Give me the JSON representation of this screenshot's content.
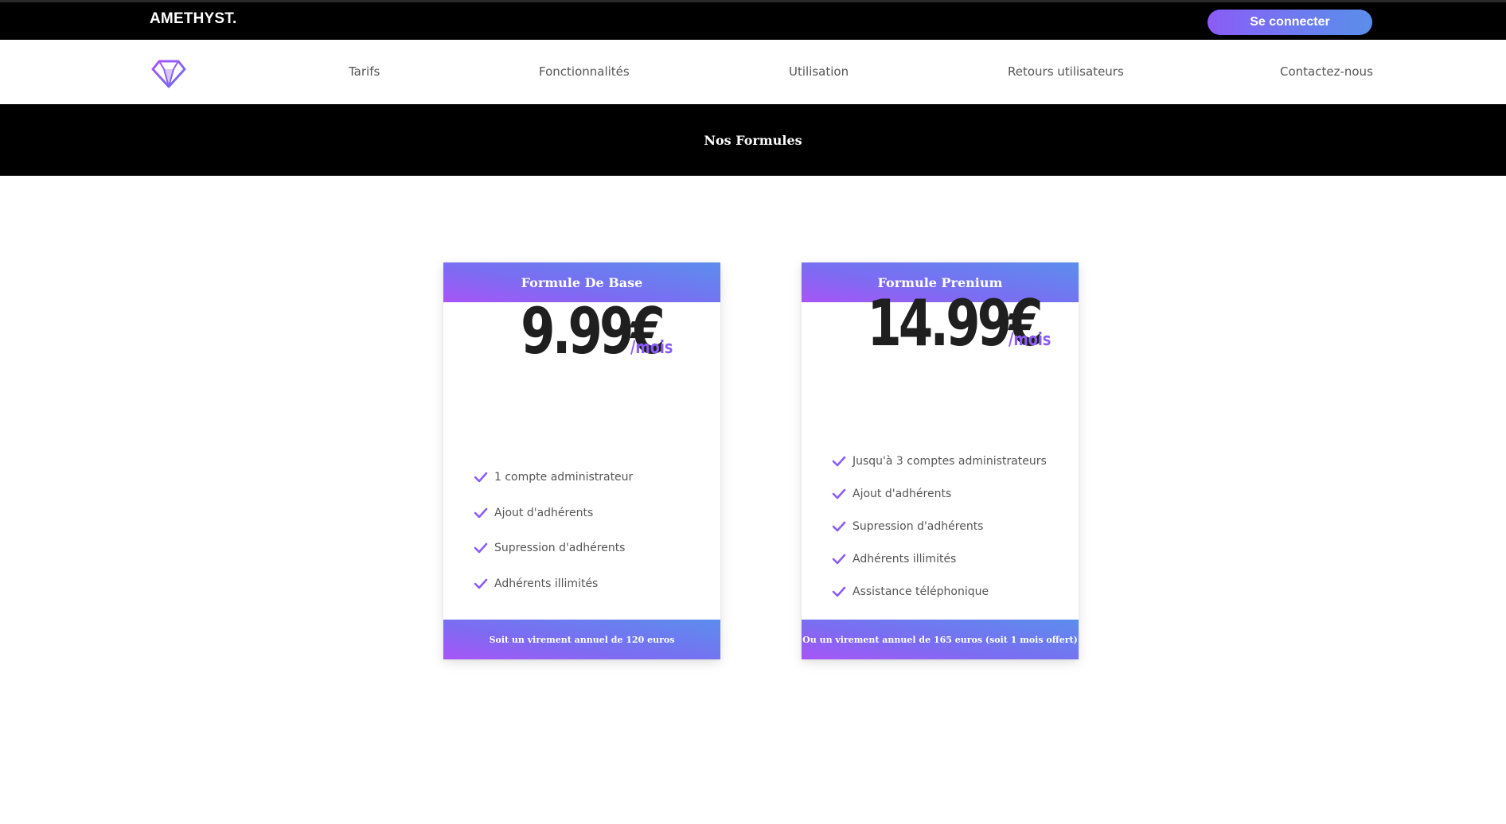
{
  "app": {
    "brand": "AMETHYST.",
    "login_label": "Se connecter"
  },
  "nav": {
    "logo_icon": "diamond-icon",
    "items": [
      {
        "label": "Tarifs"
      },
      {
        "label": "Fonctionnalités"
      },
      {
        "label": "Utilisation"
      },
      {
        "label": "Retours utilisateurs"
      },
      {
        "label": "Contactez-nous"
      }
    ]
  },
  "section": {
    "title": "Nos Formules"
  },
  "plans": [
    {
      "title": "Formule De Base",
      "price": "9.99€",
      "unit": "/mois",
      "features": [
        "1 compte administrateur",
        "Ajout d'adhérents",
        "Supression d'adhérents",
        "Adhérents illimités"
      ],
      "footer": "Soit un virement annuel de 120 euros"
    },
    {
      "title": "Formule Prenium",
      "price": "14.99€",
      "unit": "/mois",
      "features": [
        "Jusqu'à 3 comptes administrateurs",
        "Ajout d'adhérents",
        "Supression d'adhérents",
        "Adhérents illimités",
        "Assistance téléphonique"
      ],
      "footer": "Ou un virement annuel de 165 euros (soit 1 mois offert)"
    }
  ],
  "colors": {
    "accent": "#8b5cf6",
    "gradient_start": "#a855f7",
    "gradient_end": "#5b8ded",
    "topbar_bg": "#000000",
    "text_muted": "#555555"
  },
  "icons": {
    "feature_icon": "check-icon"
  }
}
